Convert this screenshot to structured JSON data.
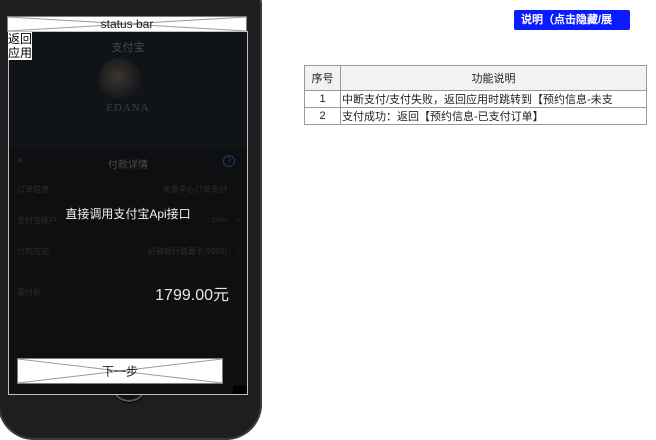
{
  "status_bar": {
    "label": "status bar"
  },
  "nav": {
    "back_label": "返回应用"
  },
  "hero": {
    "title": "支付宝",
    "brand": "EDANA"
  },
  "payment_sheet": {
    "title": "付款详情",
    "close_icon": "×",
    "help_icon": "?",
    "rows": [
      {
        "key": "订单信息",
        "value": "天爱中心订单支付",
        "arrow": ""
      },
      {
        "key": "支付宝账户",
        "value": "...com",
        "arrow": "›"
      },
      {
        "key": "付款方式",
        "value": "招商银行储蓄卡(9999)",
        "arrow": "›"
      }
    ],
    "amount_key": "需付款",
    "amount_value": "1799.00元",
    "overlay_note": "直接调用支付宝Api接口",
    "next_label": "下一步"
  },
  "explain_button": {
    "label": "说明（点击隐藏/展"
  },
  "function_table": {
    "headers": [
      "序号",
      "功能说明"
    ],
    "rows": [
      {
        "no": "1",
        "desc": "中断支付/支付失败，返回应用时跳转到【预约信息-未支"
      },
      {
        "no": "2",
        "desc": "支付成功：返回【预约信息-已支付订单】"
      }
    ]
  }
}
